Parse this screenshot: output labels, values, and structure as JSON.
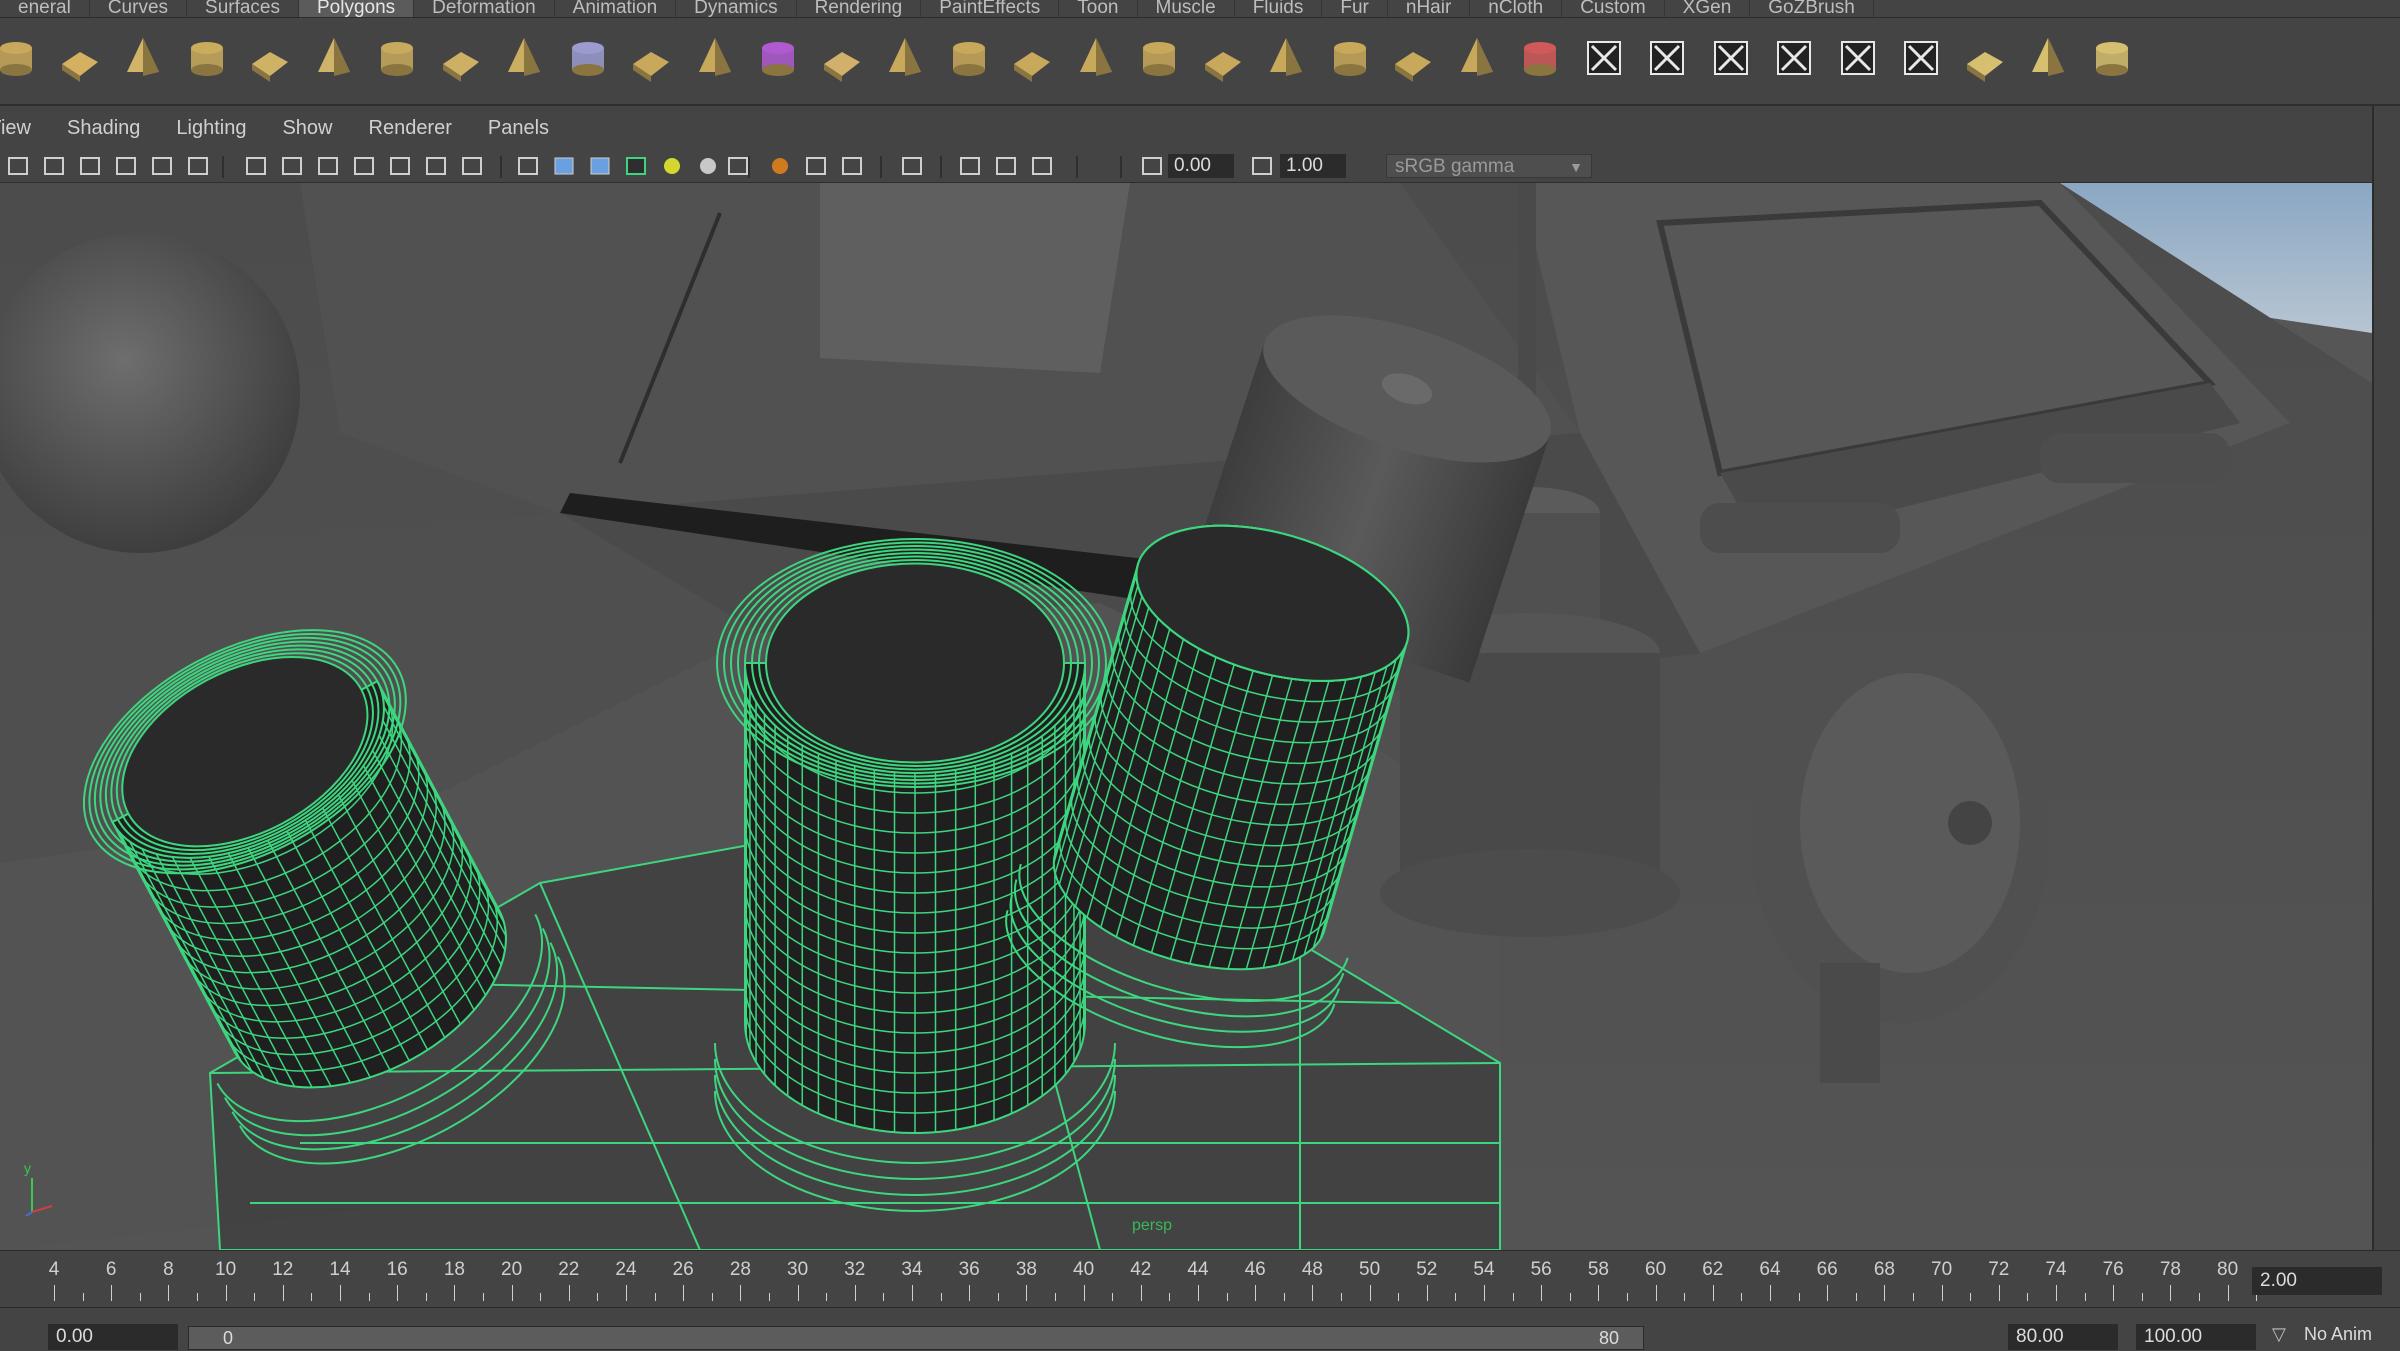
{
  "shelf": {
    "tabs": [
      {
        "label": "eneral"
      },
      {
        "label": "Curves"
      },
      {
        "label": "Surfaces"
      },
      {
        "label": "Polygons",
        "active": true
      },
      {
        "label": "Deformation"
      },
      {
        "label": "Animation"
      },
      {
        "label": "Dynamics"
      },
      {
        "label": "Rendering"
      },
      {
        "label": "PaintEffects"
      },
      {
        "label": "Toon"
      },
      {
        "label": "Muscle"
      },
      {
        "label": "Fluids"
      },
      {
        "label": "Fur"
      },
      {
        "label": "nHair"
      },
      {
        "label": "nCloth"
      },
      {
        "label": "Custom"
      },
      {
        "label": "XGen"
      },
      {
        "label": "GoZBrush"
      }
    ]
  },
  "panel_menu": [
    "View",
    "Shading",
    "Lighting",
    "Show",
    "Renderer",
    "Panels"
  ],
  "panel_toolbar": {
    "exposure": "0.00",
    "gamma": "1.00",
    "color_space": "sRGB gamma"
  },
  "viewport": {
    "camera": "persp",
    "axis_y": "y",
    "wire_color": "#3dd67f"
  },
  "time_slider": {
    "ticks": [
      "4",
      "6",
      "8",
      "10",
      "12",
      "14",
      "16",
      "18",
      "20",
      "22",
      "24",
      "26",
      "28",
      "30",
      "32",
      "34",
      "36",
      "38",
      "40",
      "42",
      "44",
      "46",
      "48",
      "50",
      "52",
      "54",
      "56",
      "58",
      "60",
      "62",
      "64",
      "66",
      "68",
      "70",
      "72",
      "74",
      "76",
      "78",
      "80"
    ],
    "current_frame": "2.00"
  },
  "range_slider": {
    "start": "0.00",
    "range_min": "0",
    "range_max": "80",
    "end": "80.00",
    "total_end": "100.00",
    "anim_layer": "No Anim"
  },
  "colors": {
    "ui_bg": "#444444",
    "field_bg": "#2b2b2b",
    "accent_green": "#3dd67f"
  }
}
